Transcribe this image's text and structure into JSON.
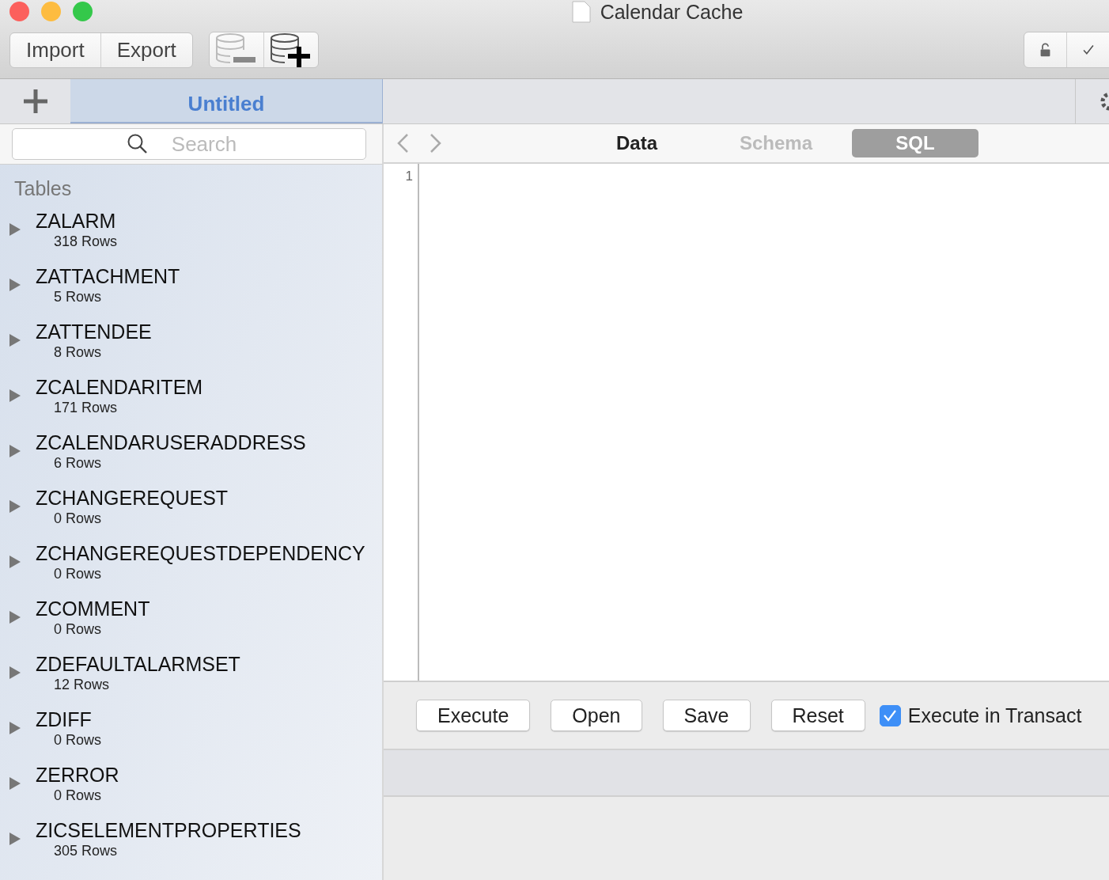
{
  "window": {
    "title": "Calendar Cache"
  },
  "toolbar": {
    "buttons": [
      {
        "label": "Import"
      },
      {
        "label": "Export"
      }
    ]
  },
  "document_tabs": [
    {
      "label": "Untitled",
      "selected": true
    }
  ],
  "search": {
    "placeholder": "Search"
  },
  "sidebar": {
    "heading": "Tables",
    "items": [
      {
        "name": "ZALARM",
        "rows": "318 Rows",
        "expanded": false
      },
      {
        "name": "ZATTACHMENT",
        "rows": "5 Rows",
        "expanded": false
      },
      {
        "name": "ZATTENDEE",
        "rows": "8 Rows",
        "expanded": false
      },
      {
        "name": "ZCALENDARITEM",
        "rows": "171 Rows",
        "expanded": false
      },
      {
        "name": "ZCALENDARUSERADDRESS",
        "rows": "6 Rows",
        "expanded": false
      },
      {
        "name": "ZCHANGEREQUEST",
        "rows": "0 Rows",
        "expanded": false
      },
      {
        "name": "ZCHANGEREQUESTDEPENDENCY",
        "rows": "0 Rows",
        "expanded": false
      },
      {
        "name": "ZCOMMENT",
        "rows": "0 Rows",
        "expanded": false
      },
      {
        "name": "ZDEFAULTALARMSET",
        "rows": "12 Rows",
        "expanded": false
      },
      {
        "name": "ZDIFF",
        "rows": "0 Rows",
        "expanded": false
      },
      {
        "name": "ZERROR",
        "rows": "0 Rows",
        "expanded": false
      },
      {
        "name": "ZICSELEMENTPROPERTIES",
        "rows": "305 Rows",
        "expanded": false
      }
    ]
  },
  "view_tabs": [
    {
      "label": "Data",
      "selected": false,
      "kind": "bold"
    },
    {
      "label": "Schema",
      "selected": false,
      "kind": "dim"
    },
    {
      "label": "SQL",
      "selected": true,
      "kind": "bold"
    }
  ],
  "editor": {
    "line_numbers": [
      "1"
    ]
  },
  "actions": [
    {
      "label": "Execute"
    },
    {
      "label": "Open"
    },
    {
      "label": "Save"
    },
    {
      "label": "Reset"
    }
  ],
  "transaction_checkbox": {
    "label": "Execute in Transact",
    "checked": true
  }
}
